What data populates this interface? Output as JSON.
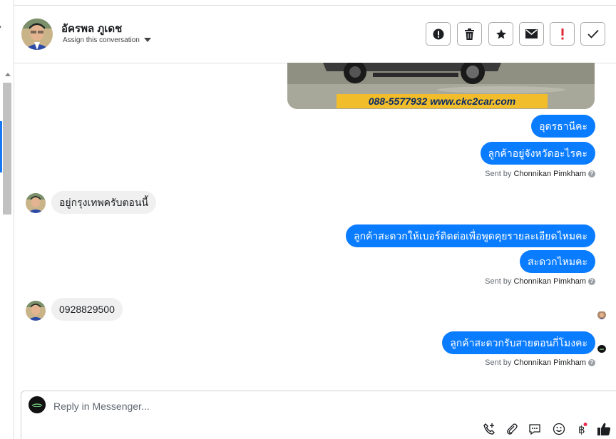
{
  "header": {
    "contact_name": "อัครพล ภูเดช",
    "assign_label": "Assign this conversation",
    "buttons": [
      {
        "name": "report-button",
        "icon": "exclamation-circle-icon"
      },
      {
        "name": "delete-button",
        "icon": "trash-icon"
      },
      {
        "name": "star-button",
        "icon": "star-icon"
      },
      {
        "name": "mark-unread-button",
        "icon": "envelope-icon"
      },
      {
        "name": "flag-button",
        "icon": "red-exclamation-icon"
      },
      {
        "name": "mark-done-button",
        "icon": "checkmark-icon"
      }
    ]
  },
  "banner": {
    "text": "088-5577932 www.ckc2car.com"
  },
  "messages": {
    "m1": "อุดรธานีคะ",
    "m2": "ลูกค้าอยู่จังหวัดอะไรคะ",
    "sent1_prefix": "Sent by",
    "sent1_name": "Chonnikan Pimkham",
    "m3": "อยู่กรุงเทพครับตอนนี้",
    "m4": "ลูกค้าสะดวกให้เบอร์ติดต่อเพื่อพูดคุยรายละเอียดไหมคะ",
    "m5": "สะดวกไหมคะ",
    "sent2_prefix": "Sent by",
    "sent2_name": "Chonnikan Pimkham",
    "m6": "0928829500",
    "m7": "ลูกค้าสะดวกรับสายตอนกี่โมงคะ",
    "sent3_prefix": "Sent by",
    "sent3_name": "Chonnikan Pimkham"
  },
  "reply": {
    "placeholder": "Reply in Messenger..."
  },
  "colors": {
    "outgoing": "#0a7cff",
    "incoming": "#f0f0f0",
    "notify": "#f02849"
  }
}
